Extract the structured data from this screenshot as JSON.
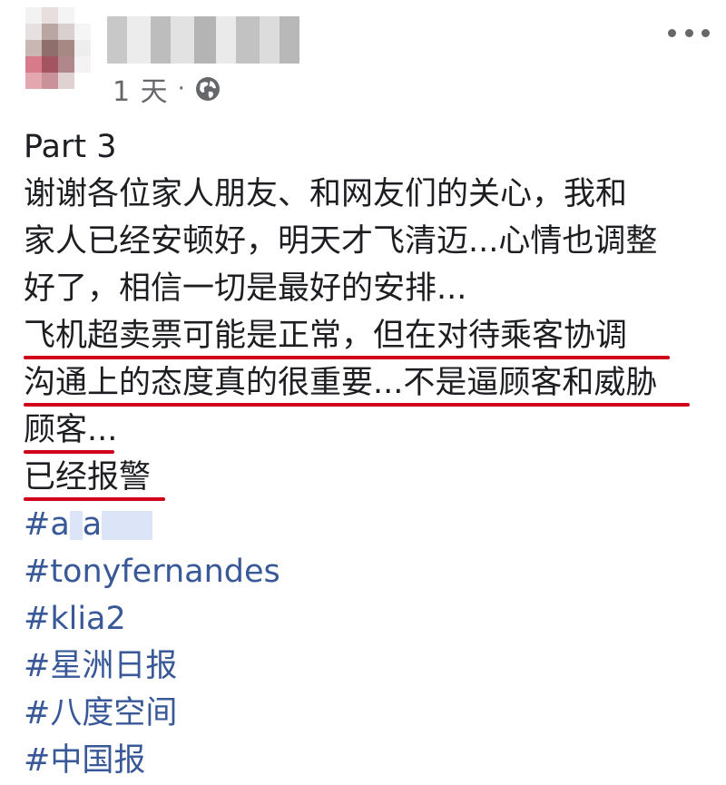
{
  "post": {
    "time": "1 天",
    "separator": "·",
    "privacy_icon": "globe-icon",
    "more_icon": "more-options-icon"
  },
  "body": {
    "lines": [
      "Part 3",
      "谢谢各位家人朋友、和网友们的关心，我和",
      "家人已经安顿好，明天才飞清迈...心情也调整",
      "好了，相信一切是最好的安排...",
      "飞机超卖票可能是正常，但在对待乘客协调",
      "沟通上的态度真的很重要...不是逼顾客和威胁",
      "顾客...",
      "已经报警"
    ]
  },
  "hashtags": {
    "tag1_part1": "#a",
    "tag1_part2": "a",
    "tag2": "#tonyfernandes",
    "tag3": "#klia2",
    "tag4": "#星洲日报",
    "tag5": "#八度空间",
    "tag6": "#中国报"
  },
  "colors": {
    "text": "#1c1e21",
    "meta": "#65676b",
    "link": "#385898",
    "underline": "#d0021b"
  }
}
